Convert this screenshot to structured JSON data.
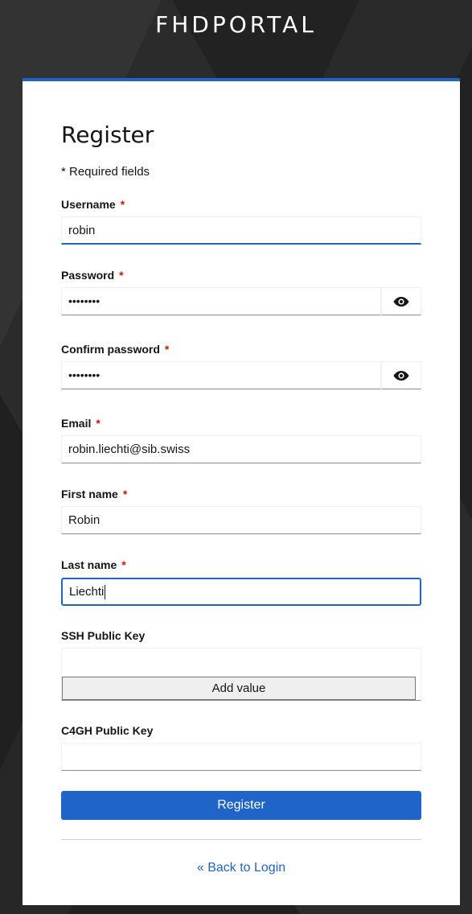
{
  "brand": "FHDPORTAL",
  "form": {
    "title": "Register",
    "required_note": "* Required fields",
    "required_marker": "*",
    "fields": {
      "username": {
        "label": "Username",
        "value": "robin"
      },
      "password": {
        "label": "Password",
        "value": "••••••••"
      },
      "confirm_password": {
        "label": "Confirm password",
        "value": "••••••••"
      },
      "email": {
        "label": "Email",
        "value": "robin.liechti@sib.swiss"
      },
      "first_name": {
        "label": "First name",
        "value": "Robin"
      },
      "last_name": {
        "label": "Last name",
        "value": "Liechti"
      },
      "ssh_public_key": {
        "label": "SSH Public Key",
        "add_value_label": "Add value"
      },
      "c4gh_public_key": {
        "label": "C4GH Public Key",
        "value": ""
      }
    },
    "submit_label": "Register",
    "back_link": "« Back to Login"
  },
  "icons": {
    "password_toggle": "eye-icon",
    "confirm_password_toggle": "eye-icon"
  },
  "colors": {
    "accent": "#1f64c8",
    "required": "#c9190b",
    "background": "#2b2b2b"
  }
}
